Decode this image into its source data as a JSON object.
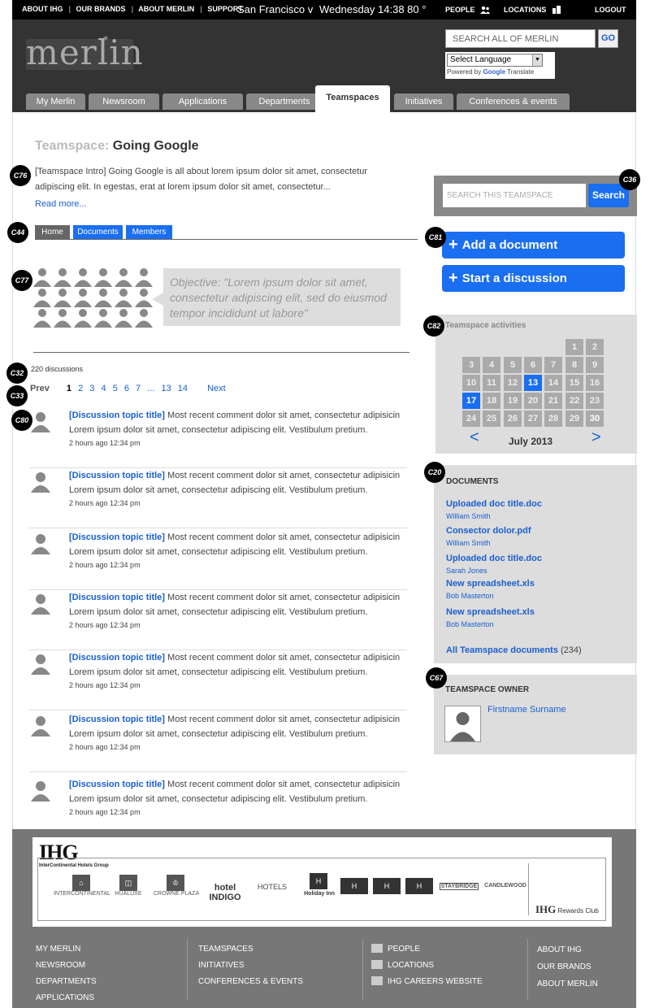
{
  "topbar": {
    "links": [
      "ABOUT IHG",
      "OUR BRANDS",
      "ABOUT MERLIN",
      "SUPPORT"
    ],
    "city": "San Francisco  v",
    "datetime": "Wednesday  14:38  80 °",
    "people": "PEOPLE",
    "locations": "LOCATIONS",
    "logout": "LOGOUT"
  },
  "header": {
    "logo": "merlin",
    "search_placeholder": "SEARCH ALL OF MERLIN",
    "go": "GO",
    "language": "Select Language",
    "powered_prefix": "Powered by",
    "powered_google": "Google",
    "powered_suffix": "Translate"
  },
  "nav": {
    "tabs": [
      "My Merlin",
      "Newsroom",
      "Applications",
      "Departments",
      "Teamspaces",
      "Initiatives",
      "Conferences & events"
    ],
    "active": "Teamspaces"
  },
  "page": {
    "title_label": "Teamspace:",
    "title": "Going Google",
    "intro": "[Teamspace Intro] Going Google is all about lorem ipsum dolor sit amet, consectetur adipiscing elit. In egestas, erat at lorem ipsum dolor sit amet, consectetur...",
    "read_more": "Read more...",
    "subtabs": [
      "Home",
      "Documents",
      "Members"
    ],
    "objective": "Objective: \"Lorem ipsum dolor sit amet, consectetur adipiscing elit, sed do eiusmod tempor incididunt ut labore\"",
    "discussion_count": "220 discussions",
    "pager": {
      "prev": "Prev",
      "pages": [
        "1",
        "2",
        "3",
        "4",
        "5",
        "6",
        "7",
        "...",
        "13",
        "14"
      ],
      "current": "1",
      "next": "Next"
    },
    "discussions": [
      {
        "title": "[Discussion topic title]",
        "text": "Most recent comment dolor sit amet, consectetur adipisicin Lorem ipsum dolor sit amet, consectetur adipiscing elit. Vestibulum pretium.",
        "time": "2 hours ago   12:34 pm"
      },
      {
        "title": "[Discussion topic title]",
        "text": "Most recent comment dolor sit amet, consectetur adipisicin Lorem ipsum dolor sit amet, consectetur adipiscing elit. Vestibulum pretium.",
        "time": "2 hours ago   12:34 pm"
      },
      {
        "title": "[Discussion topic title]",
        "text": "Most recent comment dolor sit amet, consectetur adipisicin Lorem ipsum dolor sit amet, consectetur adipiscing elit. Vestibulum pretium.",
        "time": "2 hours ago   12:34 pm"
      },
      {
        "title": "[Discussion topic title]",
        "text": "Most recent comment dolor sit amet, consectetur adipisicin Lorem ipsum dolor sit amet, consectetur adipiscing elit. Vestibulum pretium.",
        "time": "2 hours ago   12:34 pm"
      },
      {
        "title": "[Discussion topic title]",
        "text": "Most recent comment dolor sit amet, consectetur adipisicin Lorem ipsum dolor sit amet, consectetur adipiscing elit. Vestibulum pretium.",
        "time": "2 hours ago   12:34 pm"
      },
      {
        "title": "[Discussion topic title]",
        "text": "Most recent comment dolor sit amet, consectetur adipisicin Lorem ipsum dolor sit amet, consectetur adipiscing elit. Vestibulum pretium.",
        "time": "2 hours ago   12:34 pm"
      },
      {
        "title": "[Discussion topic title]",
        "text": "Most recent comment dolor sit amet, consectetur adipisicin Lorem ipsum dolor sit amet, consectetur adipiscing elit. Vestibulum pretium.",
        "time": "2 hours ago   12:34 pm"
      }
    ]
  },
  "sidebar": {
    "search_placeholder": "SEARCH THIS TEAMSPACE",
    "search_button": "Search",
    "add_document": "Add a document",
    "start_discussion": "Start a discussion",
    "activities_title": "Teamspace activities",
    "calendar": {
      "month": "July 2013",
      "prev": "<",
      "next": ">",
      "days": [
        "1",
        "2",
        "3",
        "4",
        "5",
        "6",
        "7",
        "8",
        "9",
        "10",
        "11",
        "12",
        "13",
        "14",
        "15",
        "16",
        "17",
        "18",
        "19",
        "20",
        "21",
        "22",
        "23",
        "24",
        "25",
        "26",
        "27",
        "28",
        "29",
        "30"
      ],
      "highlighted": [
        "13",
        "17"
      ]
    },
    "documents_title": "DOCUMENTS",
    "documents": [
      {
        "name": "Uploaded doc title.doc",
        "author": "William Smith"
      },
      {
        "name": "Consector dolor.pdf",
        "author": "William Smith"
      },
      {
        "name": "Uploaded doc title.doc",
        "author": "Sarah Jones"
      },
      {
        "name": "New spreadsheet.xls",
        "author": "Bob Masterton"
      },
      {
        "name": "New spreadsheet.xls",
        "author": "Bob Masterton"
      }
    ],
    "all_documents": "All Teamspace documents",
    "all_documents_count": "(234)",
    "owner_title": "TEAMSPACE OWNER",
    "owner_name": "Firstname Surname"
  },
  "badges": {
    "c76": "C76",
    "c44": "C44",
    "c77": "C77",
    "c32": "C32",
    "c33": "C33",
    "c80": "C80",
    "c36": "C36",
    "c81": "C81",
    "c82": "C82",
    "c20": "C20",
    "c67": "C67"
  },
  "footer": {
    "ihg_logo": "IHG",
    "ihg_sub": "InterContinental Hotels Group",
    "brands": [
      "INTERCONTINENTAL",
      "HUALUXE",
      "CROWNE PLAZA",
      "hotel INDIGO",
      "HOTELS",
      "Holiday Inn",
      "STAYBRIDGE",
      "CANDLEWOOD"
    ],
    "rewards": "Rewards Club",
    "col1": [
      "MY MERLIN",
      "NEWSROOM",
      "DEPARTMENTS",
      "APPLICATIONS"
    ],
    "col2": [
      "TEAMSPACES",
      "INITIATIVES",
      "CONFERENCES & EVENTS"
    ],
    "col3": [
      "PEOPLE",
      "LOCATIONS",
      "IHG CAREERS WEBSITE"
    ],
    "col4": [
      "ABOUT IHG",
      "OUR BRANDS",
      "ABOUT MERLIN"
    ]
  },
  "colors": {
    "accent_blue": "#1a6ef0",
    "link_blue": "#1a5fd0",
    "header_dark": "#333333",
    "panel_grey": "#dddddd"
  }
}
